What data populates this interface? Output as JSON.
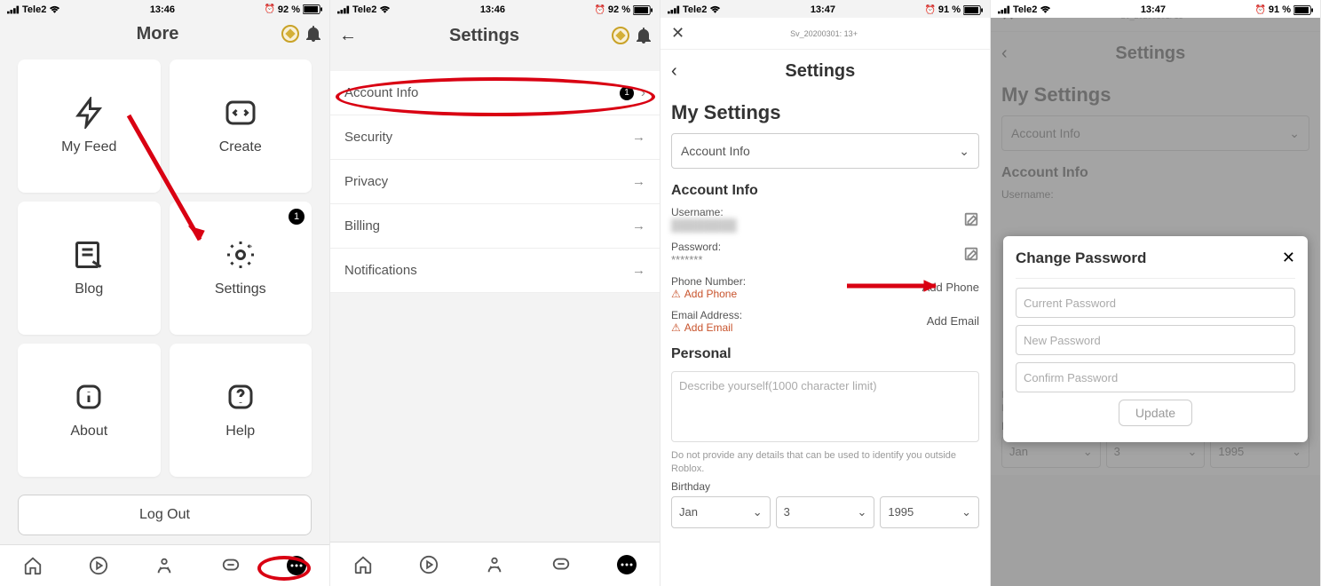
{
  "status": {
    "carrier": "Tele2",
    "time1": "13:46",
    "time2": "13:47",
    "battery1": "92 %",
    "battery2": "91 %"
  },
  "screen1": {
    "title": "More",
    "tiles": [
      {
        "label": "My Feed"
      },
      {
        "label": "Create"
      },
      {
        "label": "Blog"
      },
      {
        "label": "Settings",
        "badge": "1"
      },
      {
        "label": "About"
      },
      {
        "label": "Help"
      }
    ],
    "logout": "Log Out"
  },
  "screen2": {
    "title": "Settings",
    "rows": [
      {
        "label": "Account Info",
        "badge": "1"
      },
      {
        "label": "Security"
      },
      {
        "label": "Privacy"
      },
      {
        "label": "Billing"
      },
      {
        "label": "Notifications"
      }
    ]
  },
  "screen3": {
    "tinyTitle": "Sv_20200301: 13+",
    "subTitle": "Settings",
    "pageTitle": "My Settings",
    "selector": "Account Info",
    "section": "Account Info",
    "fields": {
      "usernameLabel": "Username:",
      "usernameVal": "",
      "passwordLabel": "Password:",
      "passwordVal": "*******",
      "phoneLabel": "Phone Number:",
      "addPhoneWarn": "Add Phone",
      "addPhoneAction": "Add Phone",
      "emailLabel": "Email Address:",
      "addEmailWarn": "Add Email",
      "addEmailAction": "Add Email"
    },
    "personal": "Personal",
    "describe": "Describe yourself(1000 character limit)",
    "caption": "Do not provide any details that can be used to identify you outside Roblox.",
    "birthdayLabel": "Birthday",
    "birthday": {
      "month": "Jan",
      "day": "3",
      "year": "1995"
    }
  },
  "screen4": {
    "modal": {
      "title": "Change Password",
      "p1": "Current Password",
      "p2": "New Password",
      "p3": "Confirm Password",
      "btn": "Update"
    }
  }
}
